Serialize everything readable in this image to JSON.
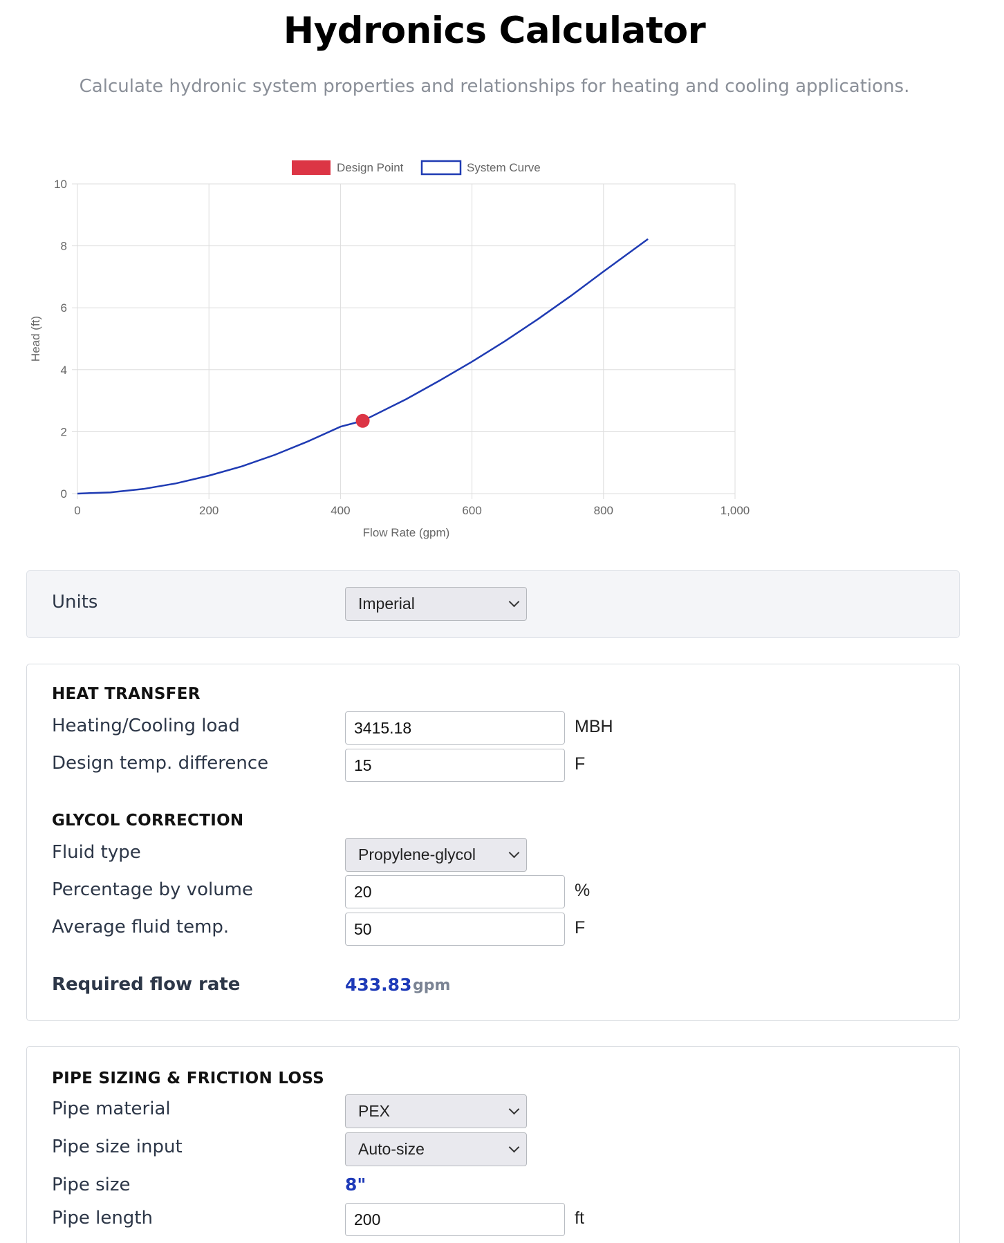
{
  "page": {
    "title": "Hydronics Calculator",
    "subtitle": "Calculate hydronic system properties and relationships for heating and cooling applications."
  },
  "chart_data": {
    "type": "line",
    "xlabel": "Flow Rate (gpm)",
    "ylabel": "Head (ft)",
    "xlim": [
      0,
      1000
    ],
    "ylim": [
      0,
      10
    ],
    "x_ticks": [
      "0",
      "200",
      "400",
      "600",
      "800",
      "1,000"
    ],
    "y_ticks": [
      "0",
      "2",
      "4",
      "6",
      "8",
      "10"
    ],
    "grid": true,
    "legend_position": "top",
    "series": [
      {
        "name": "Design Point",
        "type": "scatter",
        "color": "#dc3545",
        "x": [
          433.83
        ],
        "y": [
          2.35
        ]
      },
      {
        "name": "System Curve",
        "type": "line",
        "color": "#1f3bb3",
        "x": [
          0,
          50,
          100,
          150,
          200,
          250,
          300,
          350,
          400,
          433.83,
          500,
          550,
          600,
          650,
          700,
          750,
          800,
          867.66
        ],
        "y": [
          0,
          0.04,
          0.15,
          0.33,
          0.58,
          0.88,
          1.25,
          1.68,
          2.16,
          2.35,
          3.05,
          3.64,
          4.26,
          4.92,
          5.63,
          6.38,
          7.17,
          8.22
        ]
      }
    ]
  },
  "units": {
    "label": "Units",
    "selected": "Imperial"
  },
  "heat_transfer": {
    "heading": "HEAT TRANSFER",
    "load_label": "Heating/Cooling load",
    "load_value": "3415.18",
    "load_unit": "MBH",
    "dt_label": "Design temp. difference",
    "dt_value": "15",
    "dt_unit": "F"
  },
  "glycol": {
    "heading": "GLYCOL CORRECTION",
    "fluid_label": "Fluid type",
    "fluid_value": "Propylene-glycol",
    "pct_label": "Percentage by volume",
    "pct_value": "20",
    "pct_unit": "%",
    "temp_label": "Average fluid temp.",
    "temp_value": "50",
    "temp_unit": "F"
  },
  "result": {
    "label": "Required flow rate",
    "value": "433.83",
    "unit": "gpm"
  },
  "pipe": {
    "heading": "PIPE SIZING & FRICTION LOSS",
    "material_label": "Pipe material",
    "material_value": "PEX",
    "size_input_label": "Pipe size input",
    "size_input_value": "Auto-size",
    "size_label": "Pipe size",
    "size_value": "8\"",
    "length_label": "Pipe length",
    "length_value": "200",
    "length_unit": "ft"
  }
}
